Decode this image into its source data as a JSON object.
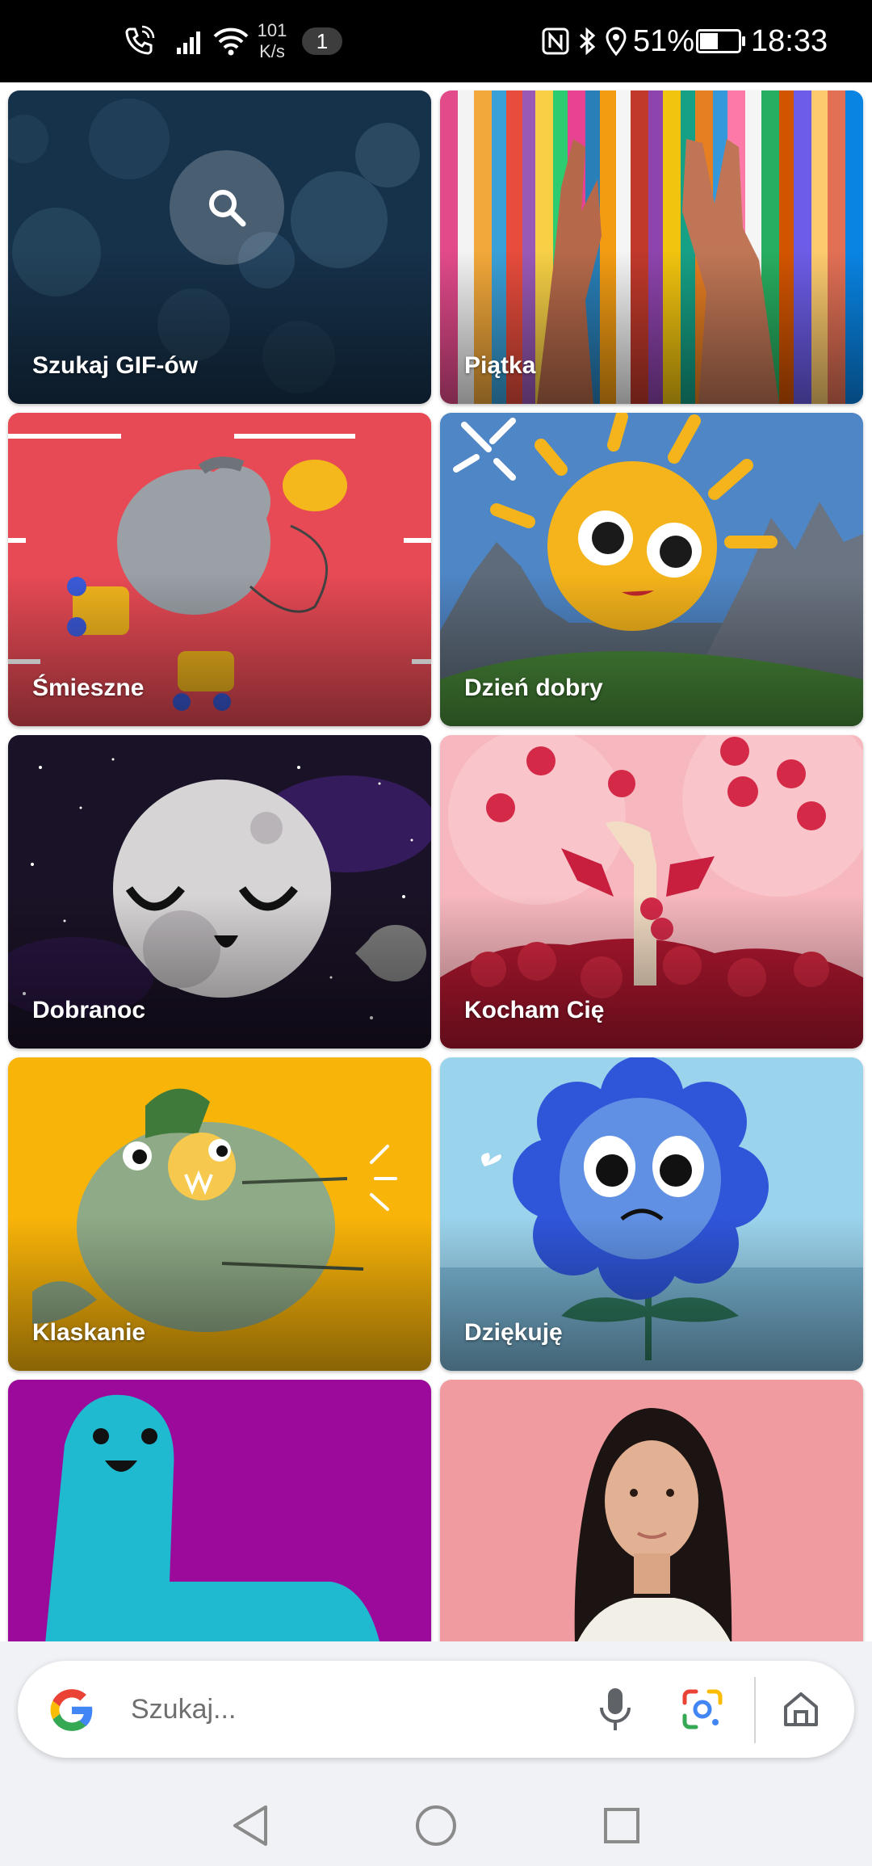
{
  "status_bar": {
    "net_speed_value": "101",
    "net_speed_unit": "K/s",
    "notification_count": "1",
    "battery_percent": "51%",
    "battery_level": 0.51,
    "time": "18:33"
  },
  "categories": [
    {
      "label": "Szukaj GIF-ów"
    },
    {
      "label": "Piątka"
    },
    {
      "label": "Śmieszne"
    },
    {
      "label": "Dzień dobry"
    },
    {
      "label": "Dobranoc"
    },
    {
      "label": "Kocham Cię"
    },
    {
      "label": "Klaskanie"
    },
    {
      "label": "Dziękuję"
    },
    {
      "label": ""
    },
    {
      "label": ""
    }
  ],
  "search": {
    "placeholder": "Szukaj..."
  },
  "icons": {
    "google": "google-logo-icon",
    "mic": "microphone-icon",
    "lens": "lens-icon",
    "home": "home-icon",
    "back": "back-icon",
    "home_nav": "home-circle-icon",
    "recents": "recents-icon"
  },
  "colors": {
    "accent_blue": "#4285F4",
    "accent_red": "#EA4335",
    "accent_yellow": "#FBBC05",
    "accent_green": "#34A853"
  }
}
